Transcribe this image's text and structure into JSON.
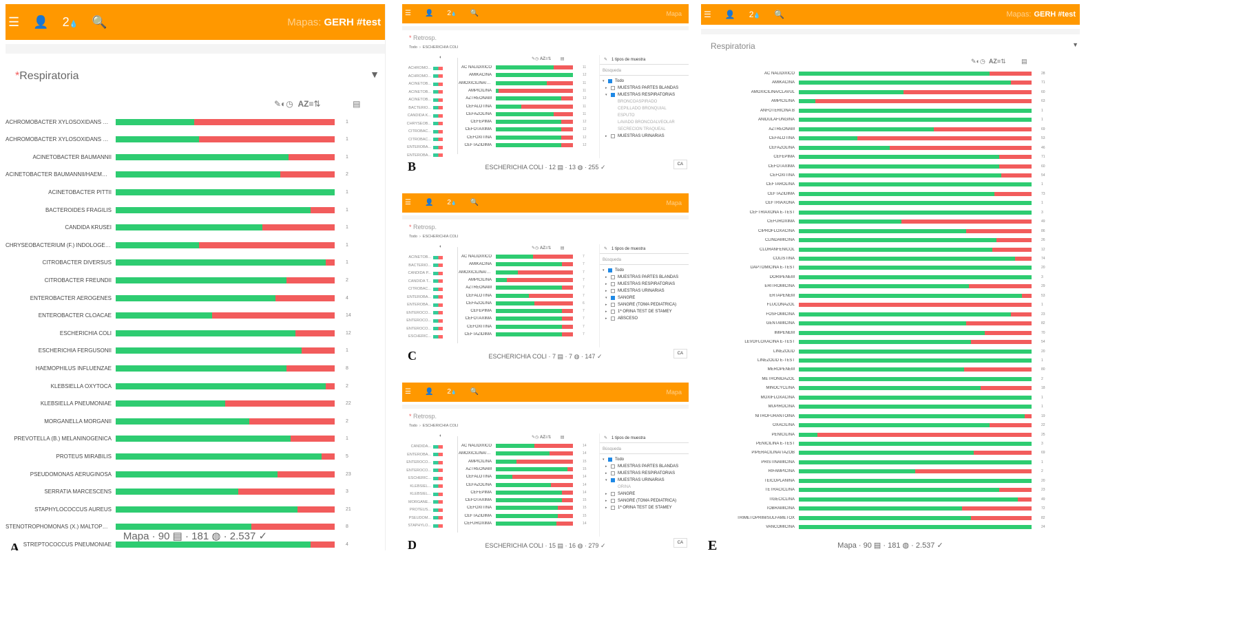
{
  "common": {
    "mapas_label": "Mapas:",
    "mapas_value": "GERH #test",
    "mapas_short": "Mapa",
    "user_count": "2",
    "user_drop": "💧",
    "retrosp": "Retrosp.",
    "breadcrumb_all": "Todo",
    "breadcrumb_sep": "›",
    "breadcrumb_org": "ESCHERICHIA COLI",
    "az": "AZ",
    "cancel": "CA",
    "busqueda": "Búsqueda",
    "todo": "Todo",
    "filter_head": "1 tipos de muestra",
    "colors": {
      "orange": "#ff9800",
      "green": "#2ecc71",
      "red": "#f25c5c"
    }
  },
  "panelA": {
    "letter": "A",
    "star": "*",
    "title": "Respiratoria",
    "footer": {
      "mapa": "Mapa",
      "organisms": "90",
      "antibiotics": "181",
      "tests": "2.537"
    },
    "rows": [
      {
        "label": "ACHROMOBACTER XYLOSOXIDANS SS DE...",
        "count": "1",
        "pct": 0.36
      },
      {
        "label": "ACHROMOBACTER XYLOSOXIDANS SS XY...",
        "count": "1",
        "pct": 0.38
      },
      {
        "label": "ACINETOBACTER BAUMANNII",
        "count": "1",
        "pct": 0.79
      },
      {
        "label": "ACINETOBACTER BAUMANNII/HAEMOLYT",
        "count": "2",
        "pct": 0.75
      },
      {
        "label": "ACINETOBACTER PITTII",
        "count": "1",
        "pct": 1.0
      },
      {
        "label": "BACTEROIDES FRAGILIS",
        "count": "1",
        "pct": 0.89
      },
      {
        "label": "CANDIDA KRUSEI",
        "count": "1",
        "pct": 0.67
      },
      {
        "label": "CHRYSEOBACTERIUM (F.) INDOLOGENES",
        "count": "1",
        "pct": 0.38
      },
      {
        "label": "CITROBACTER DIVERSUS",
        "count": "1",
        "pct": 0.96
      },
      {
        "label": "CITROBACTER FREUNDII",
        "count": "2",
        "pct": 0.78
      },
      {
        "label": "ENTEROBACTER AEROGENES",
        "count": "4",
        "pct": 0.73
      },
      {
        "label": "ENTEROBACTER CLOACAE",
        "count": "14",
        "pct": 0.44
      },
      {
        "label": "ESCHERICHIA COLI",
        "count": "12",
        "pct": 0.82
      },
      {
        "label": "ESCHERICHIA FERGUSONII",
        "count": "1",
        "pct": 0.85
      },
      {
        "label": "HAEMOPHILUS INFLUENZAE",
        "count": "8",
        "pct": 0.78
      },
      {
        "label": "KLEBSIELLA OXYTOCA",
        "count": "2",
        "pct": 0.96
      },
      {
        "label": "KLEBSIELLA PNEUMONIAE",
        "count": "22",
        "pct": 0.5
      },
      {
        "label": "MORGANELLA MORGANII",
        "count": "2",
        "pct": 0.61
      },
      {
        "label": "PREVOTELLA (B.) MELANINOGENICA",
        "count": "1",
        "pct": 0.8
      },
      {
        "label": "PROTEUS MIRABILIS",
        "count": "5",
        "pct": 0.94
      },
      {
        "label": "PSEUDOMONAS AERUGINOSA",
        "count": "23",
        "pct": 0.74
      },
      {
        "label": "SERRATIA MARCESCENS",
        "count": "3",
        "pct": 0.56
      },
      {
        "label": "STAPHYLOCOCCUS AUREUS",
        "count": "21",
        "pct": 0.83
      },
      {
        "label": "STENOTROPHOMONAS (X.) MALTOPHILIA",
        "count": "8",
        "pct": 0.62
      },
      {
        "label": "STREPTOCOCCUS PNEUMONIAE",
        "count": "4",
        "pct": 0.89
      }
    ]
  },
  "panelB": {
    "letter": "B",
    "footer": {
      "org": "ESCHERICHIA COLI",
      "a": "12",
      "b": "13",
      "c": "255"
    },
    "orgs": [
      "ACHROMO...",
      "ACHROMO...",
      "ACINETOB...",
      "ACINETOB...",
      "ACINETOB...",
      "BACTERIO...",
      "CANDIDA K...",
      "CHRYSEOB...",
      "CITROBAC...",
      "CITROBAC...",
      "ENTEROBA...",
      "ENTEROBA..."
    ],
    "rows": [
      {
        "label": "AC NALIDIXICO",
        "count": "11",
        "pct": 0.75
      },
      {
        "label": "AMIKACINA",
        "count": "12",
        "pct": 1.0
      },
      {
        "label": "AMOXICILINA/C...",
        "count": "11",
        "pct": 0.66
      },
      {
        "label": "AMPICILINA",
        "count": "11",
        "pct": 0.04
      },
      {
        "label": "AZTREONAM",
        "count": "12",
        "pct": 0.85
      },
      {
        "label": "CEFALOTINA",
        "count": "11",
        "pct": 0.33
      },
      {
        "label": "CEFAZOLINA",
        "count": "11",
        "pct": 0.75
      },
      {
        "label": "CEFEPIMA",
        "count": "12",
        "pct": 0.85
      },
      {
        "label": "CEFOTAXIMA",
        "count": "12",
        "pct": 0.85
      },
      {
        "label": "CEFOXITINA",
        "count": "12",
        "pct": 0.85
      },
      {
        "label": "CEFTAZIDIMA",
        "count": "12",
        "pct": 0.85
      }
    ],
    "filter": [
      {
        "text": "Todo",
        "cb": "on",
        "lvl": 0
      },
      {
        "text": "MUESTRAS PARTES BLANDAS",
        "cb": "off",
        "lvl": 1
      },
      {
        "text": "MUESTRAS RESPIRATORIAS",
        "cb": "on",
        "lvl": 1
      },
      {
        "text": "BRONCOASPIRADO",
        "cb": "none",
        "lvl": 2
      },
      {
        "text": "CEPILLADO BRONQUIAL",
        "cb": "none",
        "lvl": 2
      },
      {
        "text": "ESPUTO",
        "cb": "none",
        "lvl": 2
      },
      {
        "text": "LAVADO BRONCOALVEOLAR",
        "cb": "none",
        "lvl": 2
      },
      {
        "text": "SECRECION TRAQUEAL",
        "cb": "none",
        "lvl": 2
      },
      {
        "text": "MUESTRAS URINARIAS",
        "cb": "off",
        "lvl": 1
      }
    ]
  },
  "panelC": {
    "letter": "C",
    "footer": {
      "org": "ESCHERICHIA COLI",
      "a": "7",
      "b": "7",
      "c": "147"
    },
    "orgs": [
      "ACINETOB...",
      "BACTERIO...",
      "CANDIDA P...",
      "CANDIDA T...",
      "CITROBAC...",
      "ENTEROBA...",
      "ENTEROBA...",
      "ENTEROCO...",
      "ENTEROCO...",
      "ENTEROCO...",
      "ESCHERIC..."
    ],
    "rows": [
      {
        "label": "AC NALIDIXICO",
        "count": "7",
        "pct": 0.48
      },
      {
        "label": "AMIKACINA",
        "count": "7",
        "pct": 0.86
      },
      {
        "label": "AMOXICILINA/C...",
        "count": "7",
        "pct": 0.29
      },
      {
        "label": "AMPICILINA",
        "count": "7",
        "pct": 0.14
      },
      {
        "label": "AZTREONAM",
        "count": "7",
        "pct": 0.86
      },
      {
        "label": "CEFALOTINA",
        "count": "7",
        "pct": 0.43
      },
      {
        "label": "CEFAZOLINA",
        "count": "6",
        "pct": 0.5
      },
      {
        "label": "CEFEPIMA",
        "count": "7",
        "pct": 0.86
      },
      {
        "label": "CEFOTAXIMA",
        "count": "7",
        "pct": 0.86
      },
      {
        "label": "CEFOXITINA",
        "count": "7",
        "pct": 0.86
      },
      {
        "label": "CEFTAZIDIMA",
        "count": "7",
        "pct": 0.86
      }
    ],
    "filter": [
      {
        "text": "Todo",
        "cb": "on",
        "lvl": 0
      },
      {
        "text": "MUESTRAS PARTES BLANDAS",
        "cb": "off",
        "lvl": 1
      },
      {
        "text": "MUESTRAS RESPIRATORIAS",
        "cb": "off",
        "lvl": 1
      },
      {
        "text": "MUESTRAS URINARIAS",
        "cb": "off",
        "lvl": 1
      },
      {
        "text": "SANGRE",
        "cb": "on",
        "lvl": 1
      },
      {
        "text": "SANGRE (TOMA PEDIATRICA)",
        "cb": "off",
        "lvl": 1
      },
      {
        "text": "1ª ORINA TEST DE STAMEY",
        "cb": "off",
        "lvl": 1
      },
      {
        "text": "ABSCESO",
        "cb": "off",
        "lvl": 1
      }
    ]
  },
  "panelD": {
    "letter": "D",
    "footer": {
      "org": "ESCHERICHIA COLI",
      "a": "15",
      "b": "16",
      "c": "279"
    },
    "orgs": [
      "CANDIDA...",
      "ENTEROBA...",
      "ENTEROCO...",
      "ENTEROCO...",
      "ESCHERIC...",
      "KLEBSIEL...",
      "KLEBSIEL...",
      "MORGANE...",
      "PROTEUS...",
      "PSEUDOM...",
      "STAPHYLO..."
    ],
    "rows": [
      {
        "label": "AC NALIDIXICO",
        "count": "14",
        "pct": 0.5
      },
      {
        "label": "AMOXICILINA/C...",
        "count": "14",
        "pct": 0.7
      },
      {
        "label": "AMPICILINA",
        "count": "15",
        "pct": 0.27
      },
      {
        "label": "AZTREONAM",
        "count": "15",
        "pct": 0.93
      },
      {
        "label": "CEFALOTINA",
        "count": "14",
        "pct": 0.21
      },
      {
        "label": "CEFAZOLINA",
        "count": "14",
        "pct": 0.71
      },
      {
        "label": "CEFEPIMA",
        "count": "14",
        "pct": 0.86
      },
      {
        "label": "CEFOTAXIMA",
        "count": "15",
        "pct": 0.86
      },
      {
        "label": "CEFOXITINA",
        "count": "15",
        "pct": 0.8
      },
      {
        "label": "CEFTAZIDIMA",
        "count": "15",
        "pct": 0.8
      },
      {
        "label": "CEFUROXIMA",
        "count": "14",
        "pct": 0.79
      }
    ],
    "filter": [
      {
        "text": "Todo",
        "cb": "on",
        "lvl": 0
      },
      {
        "text": "MUESTRAS PARTES BLANDAS",
        "cb": "off",
        "lvl": 1
      },
      {
        "text": "MUESTRAS RESPIRATORIAS",
        "cb": "off",
        "lvl": 1
      },
      {
        "text": "MUESTRAS URINARIAS",
        "cb": "on",
        "lvl": 1
      },
      {
        "text": "ORINA",
        "cb": "none",
        "lvl": 2
      },
      {
        "text": "SANGRE",
        "cb": "off",
        "lvl": 1
      },
      {
        "text": "SANGRE (TOMA PEDIATRICA)",
        "cb": "off",
        "lvl": 1
      },
      {
        "text": "1ª ORINA TEST DE STAMEY",
        "cb": "off",
        "lvl": 1
      }
    ]
  },
  "panelE": {
    "letter": "E",
    "title": "Respiratoria",
    "footer": {
      "mapa": "Mapa",
      "organisms": "90",
      "antibiotics": "181",
      "tests": "2.537"
    },
    "rows": [
      {
        "label": "AC NALIDIXICO",
        "count": "28",
        "pct": 0.82
      },
      {
        "label": "AMIKACINA",
        "count": "71",
        "pct": 0.91
      },
      {
        "label": "AMOXICILINA/CLAVUL",
        "count": "60",
        "pct": 0.45
      },
      {
        "label": "AMPICILINA",
        "count": "63",
        "pct": 0.07
      },
      {
        "label": "ANFOTERICINA B",
        "count": "1",
        "pct": 1.0
      },
      {
        "label": "ANIDULAFUNGINA",
        "count": "1",
        "pct": 1.0
      },
      {
        "label": "AZTREONAM",
        "count": "69",
        "pct": 0.58
      },
      {
        "label": "CEFALOTINA",
        "count": "53",
        "pct": 0.25
      },
      {
        "label": "CEFAZOLINA",
        "count": "46",
        "pct": 0.39
      },
      {
        "label": "CEFEPIMA",
        "count": "71",
        "pct": 0.86
      },
      {
        "label": "CEFOTAXIMA",
        "count": "60",
        "pct": 0.86
      },
      {
        "label": "CEFOXITINA",
        "count": "54",
        "pct": 0.87
      },
      {
        "label": "CEFTAROLINA",
        "count": "1",
        "pct": 1.0
      },
      {
        "label": "CEFTAZIDIMA",
        "count": "73",
        "pct": 0.84
      },
      {
        "label": "CEFTRIAXONA",
        "count": "1",
        "pct": 1.0
      },
      {
        "label": "CEFTRIAXONA E-TEST",
        "count": "3",
        "pct": 1.0
      },
      {
        "label": "CEFUROXIMA",
        "count": "49",
        "pct": 0.44
      },
      {
        "label": "CIPROFLOXACINA",
        "count": "86",
        "pct": 0.72
      },
      {
        "label": "CLINDAMICINA",
        "count": "26",
        "pct": 0.85
      },
      {
        "label": "CLORANFENICOL",
        "count": "12",
        "pct": 0.83
      },
      {
        "label": "COLISTINA",
        "count": "74",
        "pct": 0.93
      },
      {
        "label": "DAPTOMICINA E-TEST",
        "count": "20",
        "pct": 1.0
      },
      {
        "label": "DORIPENEM",
        "count": "3",
        "pct": 1.0
      },
      {
        "label": "ERITROMICINA",
        "count": "29",
        "pct": 0.73
      },
      {
        "label": "ERTAPENEM",
        "count": "53",
        "pct": 0.96
      },
      {
        "label": "FLUCONAZOL",
        "count": "1",
        "pct": 0.0
      },
      {
        "label": "FOSFOMICINA",
        "count": "23",
        "pct": 0.91
      },
      {
        "label": "GENTAMICINA",
        "count": "82",
        "pct": 0.72
      },
      {
        "label": "IMIPENEM",
        "count": "70",
        "pct": 0.8
      },
      {
        "label": "LEVOFLOXACINA E-TEST",
        "count": "54",
        "pct": 0.74
      },
      {
        "label": "LINEZOLID",
        "count": "20",
        "pct": 1.0
      },
      {
        "label": "LINEZOLID E-TEST",
        "count": "1",
        "pct": 1.0
      },
      {
        "label": "MEROPENEM",
        "count": "80",
        "pct": 0.71
      },
      {
        "label": "METRONIDAZOL",
        "count": "2",
        "pct": 1.0
      },
      {
        "label": "MINOCYCLINA",
        "count": "18",
        "pct": 0.78
      },
      {
        "label": "MOXIFLOXACINA",
        "count": "1",
        "pct": 1.0
      },
      {
        "label": "MUPIROCINA",
        "count": "1",
        "pct": 1.0
      },
      {
        "label": "NITROFURANTOINA",
        "count": "19",
        "pct": 0.97
      },
      {
        "label": "OXACILINA",
        "count": "22",
        "pct": 0.82
      },
      {
        "label": "PENICILINA",
        "count": "25",
        "pct": 0.08
      },
      {
        "label": "PENICILINA E-TEST",
        "count": "3",
        "pct": 1.0
      },
      {
        "label": "PIPERACILINA/TAZOB",
        "count": "69",
        "pct": 0.75
      },
      {
        "label": "PRISTINAMICINA",
        "count": "1",
        "pct": 1.0
      },
      {
        "label": "RIFAMPICINA",
        "count": "2",
        "pct": 0.5
      },
      {
        "label": "TEICOPLANINA",
        "count": "20",
        "pct": 1.0
      },
      {
        "label": "TETRACICLINA",
        "count": "23",
        "pct": 0.86
      },
      {
        "label": "TIGECICLINA",
        "count": "49",
        "pct": 0.94
      },
      {
        "label": "TOBRAMICINA",
        "count": "72",
        "pct": 0.7
      },
      {
        "label": "TRIMETOPRIM/SULFAMETOX",
        "count": "82",
        "pct": 0.74
      },
      {
        "label": "VANCOMICINA",
        "count": "24",
        "pct": 1.0
      }
    ]
  }
}
